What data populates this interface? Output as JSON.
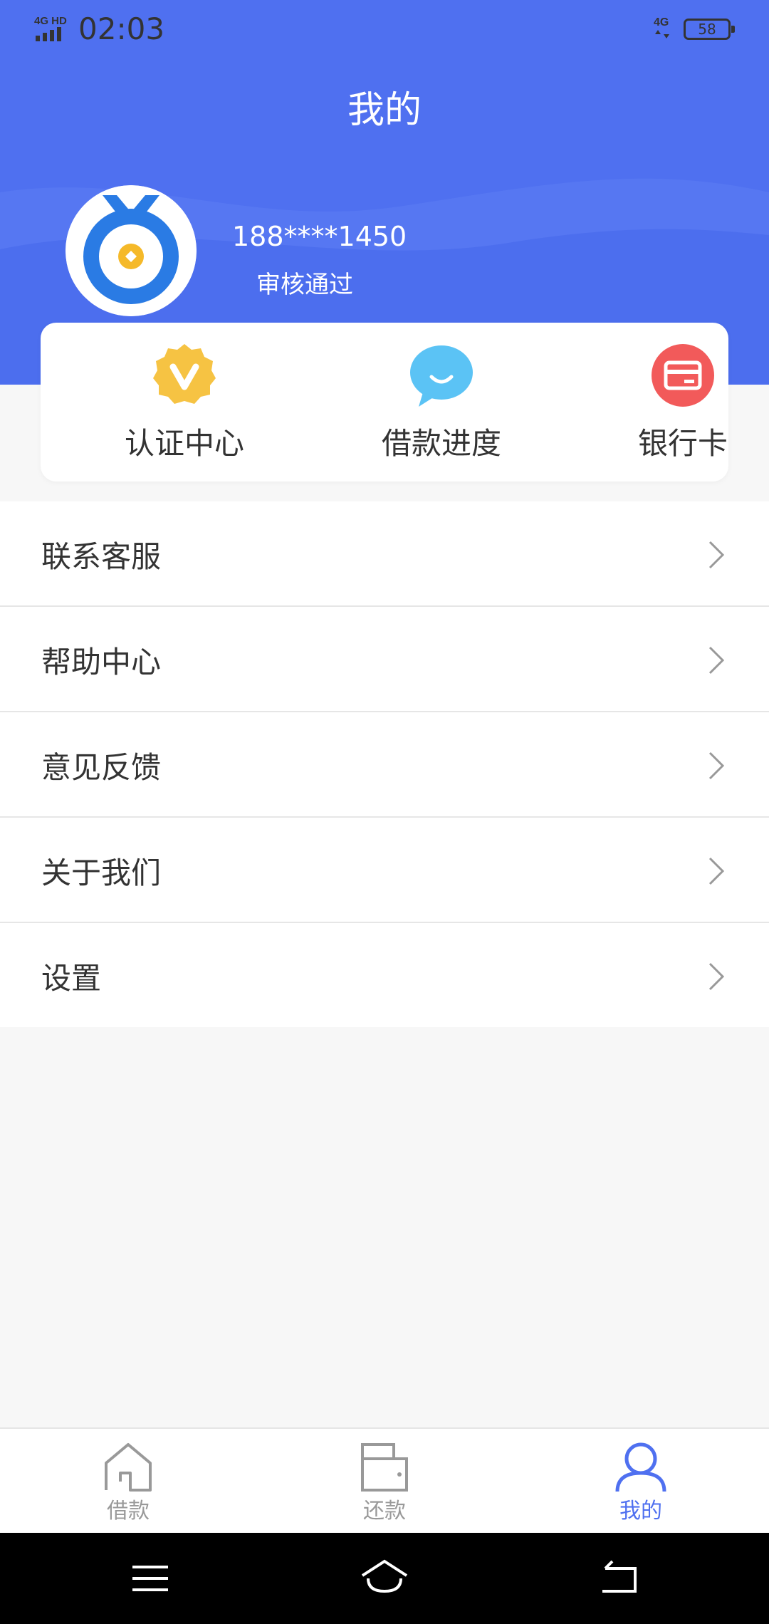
{
  "status_bar": {
    "network": "4G HD",
    "time": "02:03",
    "mobile": "4G",
    "battery": "58"
  },
  "header": {
    "title": "我的"
  },
  "profile": {
    "phone": "188****1450",
    "status": "审核通过"
  },
  "quick_actions": [
    {
      "label": "认证中心",
      "icon": "verified-badge-icon",
      "color": "#f6c343"
    },
    {
      "label": "借款进度",
      "icon": "chat-bubble-icon",
      "color": "#5bc3f5"
    },
    {
      "label": "银行卡",
      "icon": "bank-card-icon",
      "color": "#f25a5a"
    }
  ],
  "menu": [
    {
      "label": "联系客服"
    },
    {
      "label": "帮助中心"
    },
    {
      "label": "意见反馈"
    },
    {
      "label": "关于我们"
    },
    {
      "label": "设置"
    }
  ],
  "tabs": [
    {
      "label": "借款",
      "icon": "home-icon",
      "active": false
    },
    {
      "label": "还款",
      "icon": "wallet-icon",
      "active": false
    },
    {
      "label": "我的",
      "icon": "user-icon",
      "active": true
    }
  ],
  "colors": {
    "brand": "#4f70f0",
    "text": "#333333",
    "muted": "#999999"
  }
}
